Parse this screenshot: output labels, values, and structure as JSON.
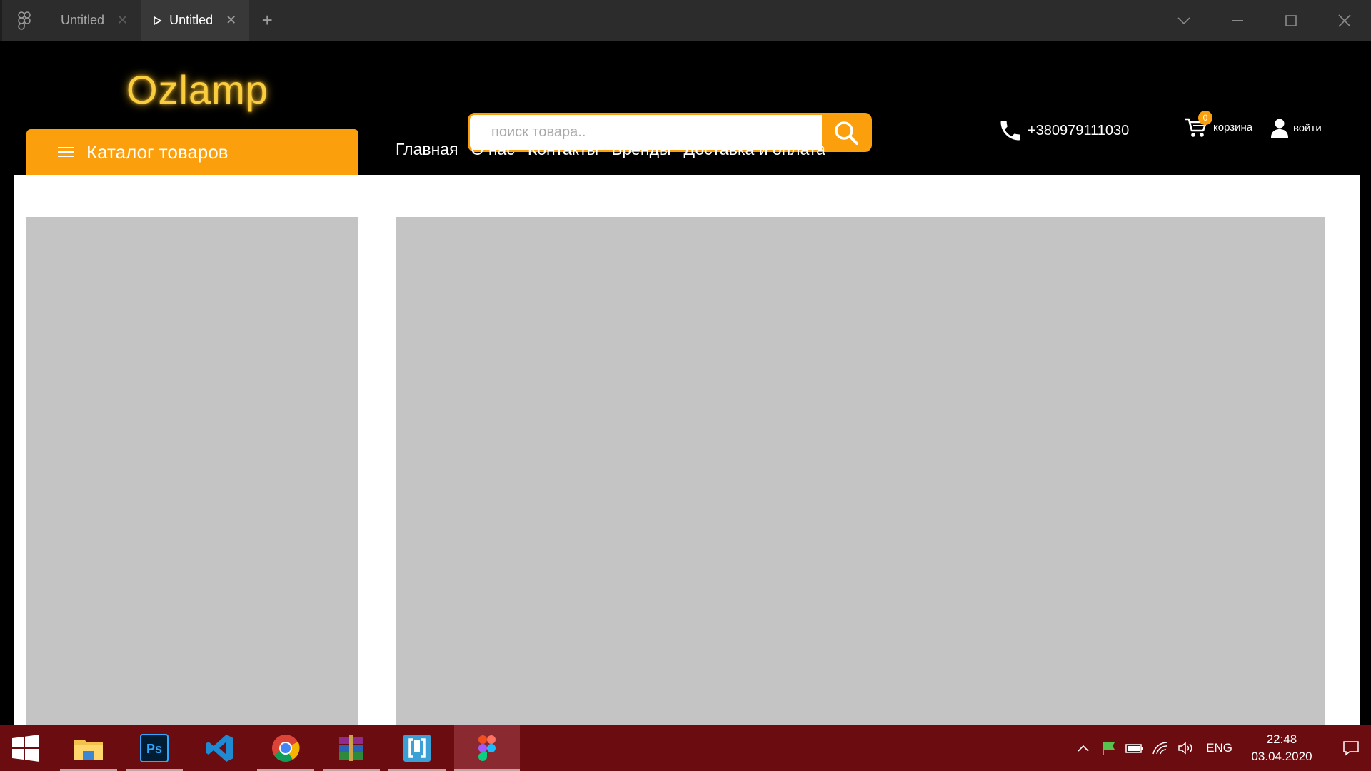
{
  "titlebar": {
    "tabs": [
      {
        "label": "Untitled",
        "active": false
      },
      {
        "label": "Untitled",
        "active": true
      }
    ],
    "add_tab_label": "+"
  },
  "site": {
    "logo": "Ozlamp",
    "search": {
      "placeholder": "поиск товара..",
      "value": ""
    },
    "phone": "+380979111030",
    "cart": {
      "label": "корзина",
      "count": "0"
    },
    "login_label": "войти",
    "catalog_label": "Каталог товаров",
    "nav": [
      "Главная",
      "О нас",
      "Контакты",
      "Бренды",
      "Доставка и оплата"
    ],
    "colors": {
      "accent": "#fb9f0d",
      "logo": "#f9cd3e",
      "placeholder": "#c4c4c4"
    }
  },
  "taskbar": {
    "apps": [
      "file-explorer-icon",
      "photoshop-icon",
      "vscode-icon",
      "chrome-icon",
      "winrar-icon",
      "bracket-app-icon",
      "figma-icon"
    ],
    "tray": {
      "language": "ENG",
      "time": "22:48",
      "date": "03.04.2020"
    },
    "color": "#6b0c11"
  }
}
